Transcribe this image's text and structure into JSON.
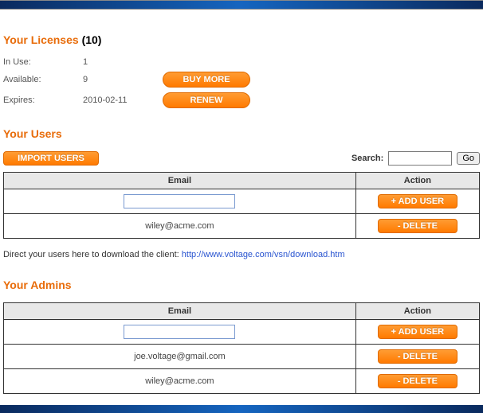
{
  "licenses": {
    "heading": "Your Licenses",
    "count": "(10)",
    "in_use_label": "In Use:",
    "in_use_value": "1",
    "available_label": "Available:",
    "available_value": "9",
    "expires_label": "Expires:",
    "expires_value": "2010-02-11",
    "buy_more_label": "BUY MORE",
    "renew_label": "RENEW"
  },
  "users": {
    "heading": "Your Users",
    "import_label": "IMPORT USERS",
    "search_label": "Search:",
    "go_label": "Go",
    "col_email": "Email",
    "col_action": "Action",
    "add_user_label": "+ ADD USER",
    "delete_label": "- DELETE",
    "rows": [
      {
        "email": "wiley@acme.com"
      }
    ],
    "download_text": "Direct your users here to download the client: ",
    "download_link": "http://www.voltage.com/vsn/download.htm"
  },
  "admins": {
    "heading": "Your Admins",
    "col_email": "Email",
    "col_action": "Action",
    "add_user_label": "+ ADD USER",
    "delete_label": "- DELETE",
    "rows": [
      {
        "email": "joe.voltage@gmail.com"
      },
      {
        "email": "wiley@acme.com"
      }
    ]
  }
}
